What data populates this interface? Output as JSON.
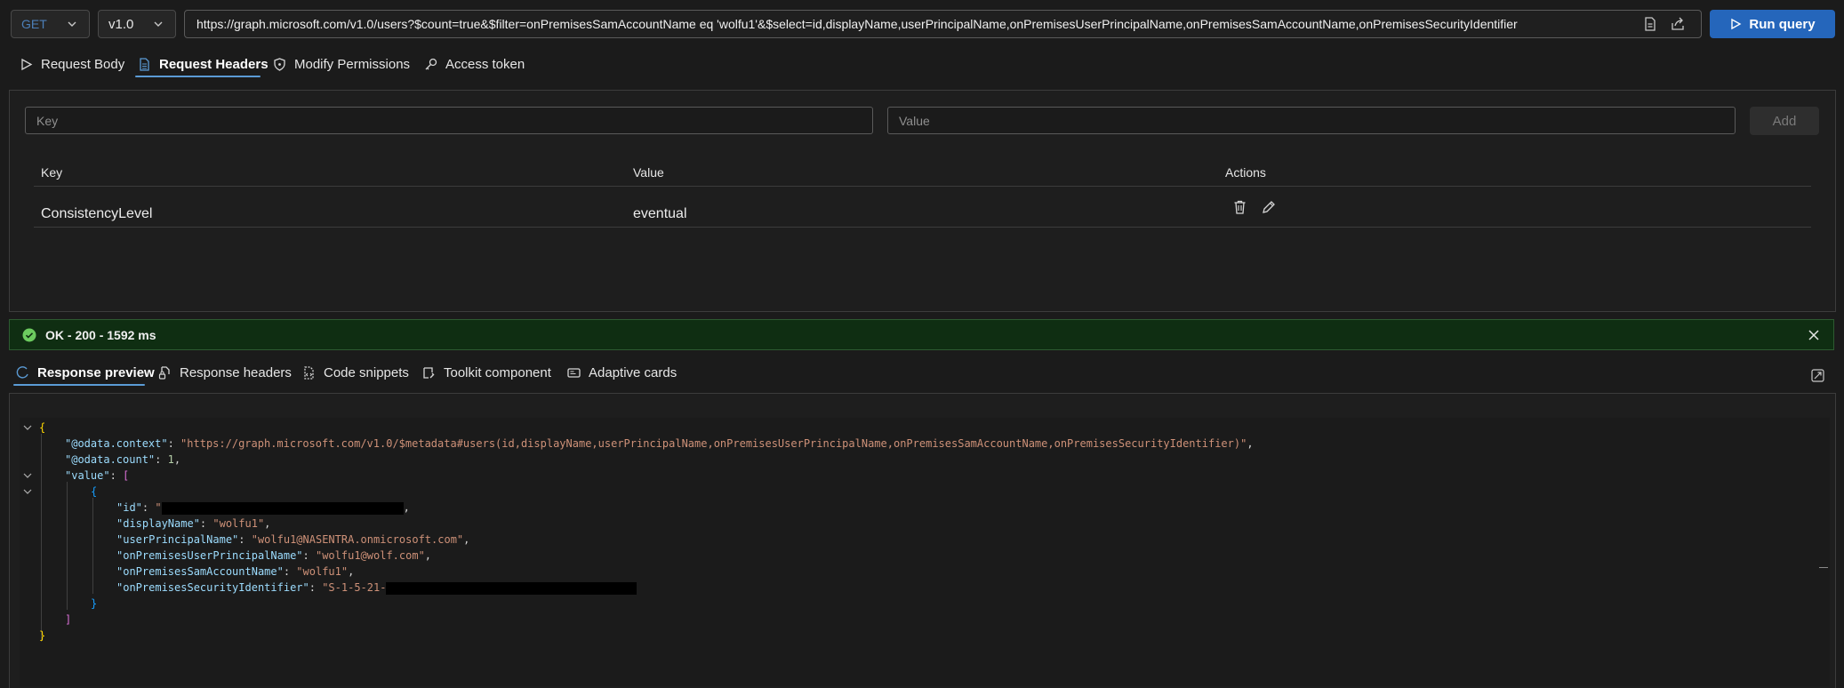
{
  "query": {
    "method": "GET",
    "version": "v1.0",
    "url": "https://graph.microsoft.com/v1.0/users?$count=true&$filter=onPremisesSamAccountName eq 'wolfu1'&$select=id,displayName,userPrincipalName,onPremisesUserPrincipalName,onPremisesSamAccountName,onPremisesSecurityIdentifier",
    "run_label": "Run query"
  },
  "request_tabs": [
    {
      "label": "Request Body",
      "icon": "play-outline-icon"
    },
    {
      "label": "Request Headers",
      "icon": "document-icon",
      "active": true
    },
    {
      "label": "Modify Permissions",
      "icon": "shield-icon"
    },
    {
      "label": "Access token",
      "icon": "key-icon"
    }
  ],
  "headers_panel": {
    "key_placeholder": "Key",
    "value_placeholder": "Value",
    "add_label": "Add",
    "columns": [
      "Key",
      "Value",
      "Actions"
    ],
    "rows": [
      {
        "key": "ConsistencyLevel",
        "value": "eventual"
      }
    ]
  },
  "status": {
    "text": "OK - 200 - 1592 ms",
    "color": "#107c10"
  },
  "response_tabs": [
    {
      "label": "Response preview",
      "icon": "preview-icon",
      "active": true
    },
    {
      "label": "Response headers",
      "icon": "document-lock-icon"
    },
    {
      "label": "Code snippets",
      "icon": "code-document-icon"
    },
    {
      "label": "Toolkit component",
      "icon": "toolkit-icon"
    },
    {
      "label": "Adaptive cards",
      "icon": "card-icon"
    }
  ],
  "response": {
    "open_brace": "{",
    "odata_context_key": "\"@odata.context\"",
    "odata_context_value": "\"https://graph.microsoft.com/v1.0/$metadata#users(id,displayName,userPrincipalName,onPremisesUserPrincipalName,onPremisesSamAccountName,onPremisesSecurityIdentifier)\"",
    "odata_count_key": "\"@odata.count\"",
    "odata_count_value": "1",
    "value_key": "\"value\"",
    "open_bracket": "[",
    "inner_open": "{",
    "id_key": "\"id\"",
    "id_value_prefix": "\"",
    "displayName_key": "\"displayName\"",
    "displayName_value": "\"wolfu1\"",
    "upn_key": "\"userPrincipalName\"",
    "upn_value": "\"wolfu1@NASENTRA.onmicrosoft.com\"",
    "onprem_upn_key": "\"onPremisesUserPrincipalName\"",
    "onprem_upn_value": "\"wolfu1@wolf.com\"",
    "sam_key": "\"onPremisesSamAccountName\"",
    "sam_value": "\"wolfu1\"",
    "sid_key": "\"onPremisesSecurityIdentifier\"",
    "sid_value_prefix": "\"S-1-5-21-",
    "inner_close": "}",
    "close_bracket": "]",
    "close_brace": "}"
  }
}
